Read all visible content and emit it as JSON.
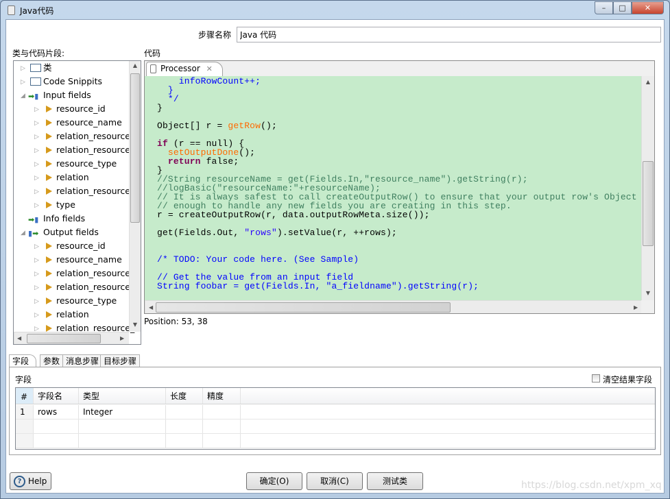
{
  "window": {
    "title": "Java代码",
    "min": "–",
    "max": "□",
    "close": "✕"
  },
  "step": {
    "label": "步骤名称",
    "value": "Java 代码"
  },
  "left_label": "类与代码片段:",
  "code_label": "代码",
  "tree": [
    {
      "label": "类",
      "type": "folder",
      "level": 0
    },
    {
      "label": "Code Snippits",
      "type": "folder",
      "level": 0
    },
    {
      "label": "Input fields",
      "type": "input",
      "level": 0,
      "expanded": true
    },
    {
      "label": "resource_id",
      "type": "leaf",
      "level": 1
    },
    {
      "label": "resource_name",
      "type": "leaf",
      "level": 1
    },
    {
      "label": "relation_resource_",
      "type": "leaf",
      "level": 1
    },
    {
      "label": "relation_resource_",
      "type": "leaf",
      "level": 1
    },
    {
      "label": "resource_type",
      "type": "leaf",
      "level": 1
    },
    {
      "label": "relation",
      "type": "leaf",
      "level": 1
    },
    {
      "label": "relation_resource_",
      "type": "leaf",
      "level": 1
    },
    {
      "label": "type",
      "type": "leaf",
      "level": 1
    },
    {
      "label": "Info fields",
      "type": "info",
      "level": 0
    },
    {
      "label": "Output fields",
      "type": "output",
      "level": 0,
      "expanded": true
    },
    {
      "label": "resource_id",
      "type": "leaf",
      "level": 1
    },
    {
      "label": "resource_name",
      "type": "leaf",
      "level": 1
    },
    {
      "label": "relation_resource_",
      "type": "leaf",
      "level": 1
    },
    {
      "label": "relation_resource_",
      "type": "leaf",
      "level": 1
    },
    {
      "label": "resource_type",
      "type": "leaf",
      "level": 1
    },
    {
      "label": "relation",
      "type": "leaf",
      "level": 1
    },
    {
      "label": "relation_resource_",
      "type": "leaf",
      "level": 1
    }
  ],
  "editor": {
    "tab_label": "Processor",
    "code": [
      [
        [
          "b",
          "    infoRowCount++;"
        ]
      ],
      [
        [
          "b",
          "  }"
        ]
      ],
      [
        [
          "b",
          "  */"
        ]
      ],
      [
        [
          "n",
          "}"
        ]
      ],
      [],
      [
        [
          "n",
          "Object[] r = "
        ],
        [
          "m",
          "getRow"
        ],
        [
          "n",
          "();"
        ]
      ],
      [],
      [
        [
          "k",
          "if"
        ],
        [
          "n",
          " (r == null) {"
        ]
      ],
      [
        [
          "n",
          "  "
        ],
        [
          "m",
          "setOutputDone"
        ],
        [
          "n",
          "();"
        ]
      ],
      [
        [
          "n",
          "  "
        ],
        [
          "k",
          "return"
        ],
        [
          "n",
          " false;"
        ]
      ],
      [
        [
          "n",
          "}"
        ]
      ],
      [
        [
          "c",
          "//String resourceName = get(Fields.In,\"resource_name\").getString(r);"
        ]
      ],
      [
        [
          "c",
          "//logBasic(\"resourceName:\"+resourceName);"
        ]
      ],
      [
        [
          "c",
          "// It is always safest to call createOutputRow() to ensure that your output row's Object"
        ]
      ],
      [
        [
          "c",
          "// enough to handle any new fields you are creating in this step."
        ]
      ],
      [
        [
          "n",
          "r = createOutputRow(r, data.outputRowMeta.size());"
        ]
      ],
      [],
      [
        [
          "n",
          "get(Fields.Out, "
        ],
        [
          "s",
          "\"rows\""
        ],
        [
          "n",
          ").setValue(r, ++rows);"
        ]
      ],
      [],
      [],
      [
        [
          "b",
          "/* TODO: Your code here. (See Sample)"
        ]
      ],
      [],
      [
        [
          "b",
          "// Get the value from an input field"
        ]
      ],
      [
        [
          "b",
          "String foobar = get(Fields.In, \"a_fieldname\").getString(r);"
        ]
      ]
    ]
  },
  "position": "Position: 53, 38",
  "tabs": [
    "字段",
    "参数",
    "消息步骤",
    "目标步骤"
  ],
  "fields_panel": {
    "label": "字段",
    "clear_checkbox": "清空结果字段",
    "clear_checked": false,
    "columns": [
      "#",
      "字段名",
      "类型",
      "长度",
      "精度"
    ],
    "rows": [
      [
        "1",
        "rows",
        "Integer",
        "",
        ""
      ]
    ]
  },
  "buttons": {
    "help": "Help",
    "ok": "确定(O)",
    "cancel": "取消(C)",
    "test": "测试类"
  },
  "watermark": "https://blog.csdn.net/xpm_xq"
}
